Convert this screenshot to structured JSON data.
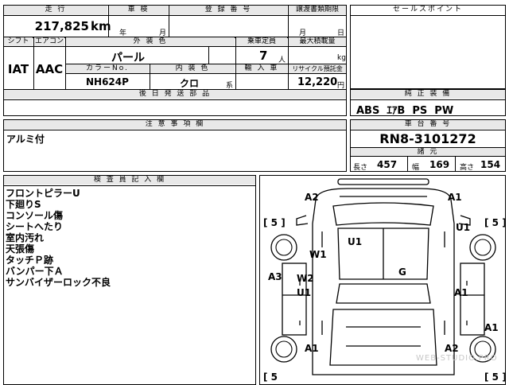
{
  "top": {
    "mileage": {
      "label": "走 行",
      "value": "217,825",
      "unit": "km"
    },
    "inspection": {
      "label": "車 検",
      "year_label": "年",
      "month_label": "月"
    },
    "registration": {
      "label": "登 録 番 号"
    },
    "transfer_deadline": {
      "label": "譲渡書類期限",
      "month_label": "月",
      "day_label": "日"
    }
  },
  "row2": {
    "shift": {
      "label": "シフト",
      "value": "IAT"
    },
    "aircon": {
      "label": "エアコン",
      "value": "AAC"
    },
    "exterior_color": {
      "label": "外 装 色",
      "value": "パール"
    },
    "capacity": {
      "label": "乗車定員",
      "value": "7",
      "unit": "人"
    },
    "max_load": {
      "label": "最大積載量",
      "unit": "kg"
    },
    "color_no": {
      "label": "カラーNo.",
      "value": "NH624P"
    },
    "interior_color": {
      "label": "内 装 色",
      "value": "クロ",
      "unit": "系"
    },
    "import": {
      "label": "輸 入 車"
    },
    "recycle": {
      "label": "リサイクル預託金",
      "value": "12,220",
      "unit": "円"
    }
  },
  "later_docs": {
    "label": "後 日 発 送 部 品"
  },
  "sales_point": {
    "label": "セールスポイント"
  },
  "equipment": {
    "label": "純 正 装 備",
    "value": "ABS  ｴｱB  PS  PW"
  },
  "notes": {
    "label": "注 意 事 項 欄",
    "value": "アルミ付"
  },
  "chassis": {
    "label": "車 台 番 号",
    "value": "RN8-3101272"
  },
  "specs": {
    "label": "諸 元",
    "length_label": "長さ",
    "length": "457",
    "width_label": "幅",
    "width": "169",
    "height_label": "高さ",
    "height": "154"
  },
  "inspector": {
    "label": "検 査 員 記 入 欄",
    "lines": [
      "フロントピラーU",
      "下廻りS",
      "コンソール傷",
      "シートへたり",
      "室内汚れ",
      "天張傷",
      "タッチＰ跡",
      "バンパー下Ａ",
      "サンバイザーロック不良"
    ]
  },
  "diagram": {
    "marks": {
      "a2_top": "A2",
      "a1_top": "A1",
      "br_left_top": "[ 5 ]",
      "br_right_top": "[ 5 ]",
      "u1_roof": "U1",
      "u1_right": "U1",
      "w1": "W1",
      "g": "G",
      "a3": "A3",
      "w2": "W2",
      "u1_left": "U1",
      "a1_right_mid": "A1",
      "a1_right_low": "A1",
      "a1_bottom_left": "A1",
      "a2_bottom_right": "A2",
      "br_left_bottom": "[ 5",
      "br_right_bottom": "[ 5 ]"
    },
    "watermark": "WEB-STUDIO.PRO"
  }
}
